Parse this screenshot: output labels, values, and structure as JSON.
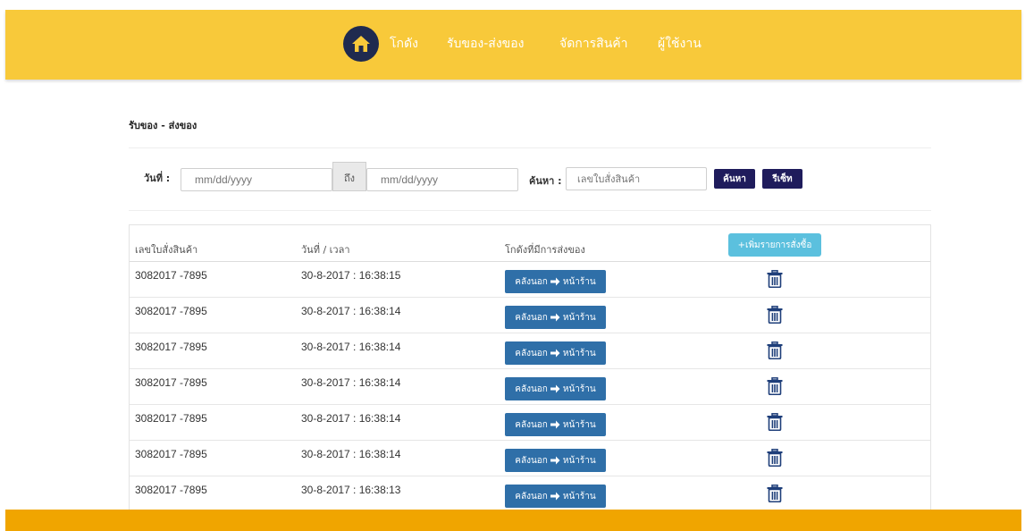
{
  "nav": {
    "items": [
      "โกดัง",
      "รับของ-ส่งของ",
      "จัดการสินค้า",
      "ผู้ใช้งาน"
    ]
  },
  "breadcrumb": "รับของ - ส่งของ",
  "filter": {
    "date_label": "วันที่ :",
    "from_placeholder": "mm/dd/yyyy",
    "to_label": "ถึง",
    "to_placeholder": "mm/dd/yyyy",
    "search_label": "ค้นหา :",
    "search_placeholder": "เลขใบสั่งสินค้า",
    "search_button": "ค้นหา",
    "reset_button": "รีเซ็ท"
  },
  "table": {
    "headers": [
      "เลขใบสั่งสินค้า",
      "วันที่ / เวลา",
      "โกดังที่มีการส่งของ"
    ],
    "add_button": "+เพิ่มรายการสั่งซื้อ",
    "rows": [
      {
        "order": "3082017 -7895",
        "datetime": "30-8-2017 : 16:38:15",
        "route_from": "คลังนอก",
        "route_to": "หน้าร้าน"
      },
      {
        "order": "3082017 -7895",
        "datetime": "30-8-2017 : 16:38:14",
        "route_from": "คลังนอก",
        "route_to": "หน้าร้าน"
      },
      {
        "order": "3082017 -7895",
        "datetime": "30-8-2017 : 16:38:14",
        "route_from": "คลังนอก",
        "route_to": "หน้าร้าน"
      },
      {
        "order": "3082017 -7895",
        "datetime": "30-8-2017 : 16:38:14",
        "route_from": "คลังนอก",
        "route_to": "หน้าร้าน"
      },
      {
        "order": "3082017 -7895",
        "datetime": "30-8-2017 : 16:38:14",
        "route_from": "คลังนอก",
        "route_to": "หน้าร้าน"
      },
      {
        "order": "3082017 -7895",
        "datetime": "30-8-2017 : 16:38:14",
        "route_from": "คลังนอก",
        "route_to": "หน้าร้าน"
      },
      {
        "order": "3082017 -7895",
        "datetime": "30-8-2017 : 16:38:13",
        "route_from": "คลังนอก",
        "route_to": "หน้าร้าน"
      }
    ]
  },
  "colors": {
    "header": "#f8c93a",
    "footer": "#f0a500",
    "logo_circle": "#1f2a4f",
    "route_button": "#2f6fa8",
    "dark_button": "#1f1c5c",
    "add_button": "#5bc0de"
  },
  "icons": {
    "logo": "home-icon",
    "arrow": "arrow-right-icon",
    "delete": "trash-icon"
  }
}
